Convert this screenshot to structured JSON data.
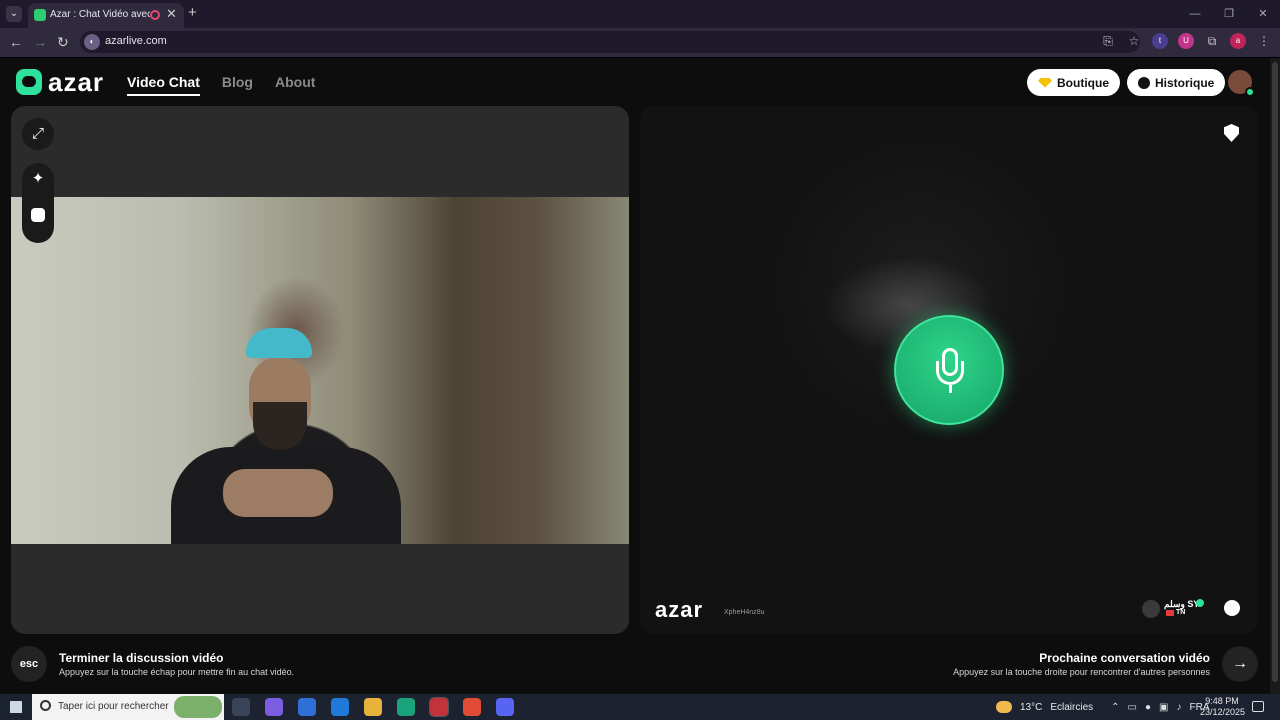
{
  "browser": {
    "tab_title": "Azar : Chat Vidéo avec de n",
    "url": "azarlive.com",
    "new_tab": "+",
    "close_tab": "✕",
    "back": "←",
    "forward": "→",
    "reload": "↻",
    "extensions": [
      "t",
      "U",
      "a"
    ],
    "window_controls": [
      "—",
      "❐",
      "✕"
    ]
  },
  "site": {
    "logo_text": "azar",
    "nav": [
      {
        "label": "Video Chat",
        "active": true
      },
      {
        "label": "Blog",
        "active": false
      },
      {
        "label": "About",
        "active": false
      }
    ],
    "boutique_label": "Boutique",
    "historique_label": "Historique"
  },
  "remote": {
    "watermark_logo": "azar",
    "watermark_id": "XpheH4nz8u",
    "peer_name": "وسلم SY",
    "peer_country": "TN"
  },
  "footer": {
    "esc_label": "esc",
    "end_title": "Terminer la discussion vidéo",
    "end_subtitle": "Appuyez sur la touche échap pour mettre fin au chat vidéo.",
    "next_title": "Prochaine conversation vidéo",
    "next_subtitle": "Appuyez sur la touche droite pour rencontrer d'autres personnes",
    "next_arrow": "→"
  },
  "taskbar": {
    "search_placeholder": "Taper ici pour rechercher",
    "weather_temp": "13°C",
    "weather_desc": "Eclaircies",
    "language": "FRA",
    "time": "9:48 PM",
    "date": "23/12/2025"
  },
  "colors": {
    "accent_green": "#2ed58a",
    "brand_green": "#2ee29b",
    "gem_yellow": "#f5c20b"
  }
}
